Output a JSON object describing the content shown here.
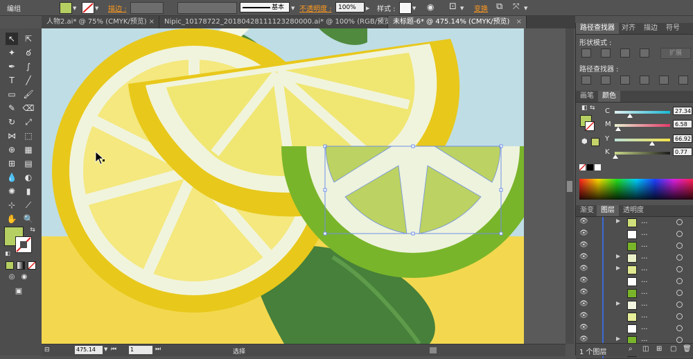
{
  "control_bar": {
    "selection_label": "编组",
    "stroke_label": "描边 :",
    "stroke_profile": "基本",
    "opacity_label": "不透明度 :",
    "opacity_value": "100%",
    "style_label": "样式 :",
    "transform_label": "变换",
    "fill_color": "#b5cf62"
  },
  "tabs": [
    {
      "label": "人物2.ai* @ 75% (CMYK/预览)",
      "close": "×"
    },
    {
      "label": "Nipic_10178722_20180428111123280000.ai* @ 100% (RGB/预览)",
      "close": "×"
    },
    {
      "label": "未标题-6* @ 475.14% (CMYK/预览)",
      "close": "×"
    }
  ],
  "pathfinder": {
    "tabs": [
      "路径查找器",
      "对齐",
      "描边",
      "符号"
    ],
    "shape_modes_label": "形状模式 :",
    "expand_label": "扩展",
    "pathfinders_label": "路径查找器 :"
  },
  "color_panel": {
    "tabs": [
      "画笔",
      "颜色"
    ],
    "channels": [
      {
        "label": "C",
        "value": "27.34",
        "level": 27.34,
        "gradient": "#e0f0f0,#19b8d4"
      },
      {
        "label": "M",
        "value": "6.58",
        "level": 6.58,
        "gradient": "#e8f0d0,#e33a6a"
      },
      {
        "label": "Y",
        "value": "66.92",
        "level": 66.92,
        "gradient": "#bde0d8,#f2e24a"
      },
      {
        "label": "K",
        "value": "0.77",
        "level": 0.77,
        "gradient": "#c8d98a,#1c1c1c"
      }
    ]
  },
  "layers_panel": {
    "tabs": [
      "渐变",
      "图层",
      "透明度"
    ],
    "rows": [
      {
        "dots": "...",
        "expand": "▶"
      },
      {
        "dots": "...",
        "expand": ""
      },
      {
        "dots": "...",
        "expand": ""
      },
      {
        "dots": "...",
        "expand": "▶"
      },
      {
        "dots": "...",
        "expand": "▶"
      },
      {
        "dots": "...",
        "expand": ""
      },
      {
        "dots": "...",
        "expand": ""
      },
      {
        "dots": "...",
        "expand": "▶"
      },
      {
        "dots": "...",
        "expand": ""
      },
      {
        "dots": "...",
        "expand": ""
      },
      {
        "dots": "...",
        "expand": "▶"
      },
      {
        "dots": "...",
        "expand": "▶"
      }
    ],
    "footer_label": "1 个图层"
  },
  "status_bar": {
    "zoom": "475.14",
    "artboard": "1",
    "tool_label": "选择"
  }
}
